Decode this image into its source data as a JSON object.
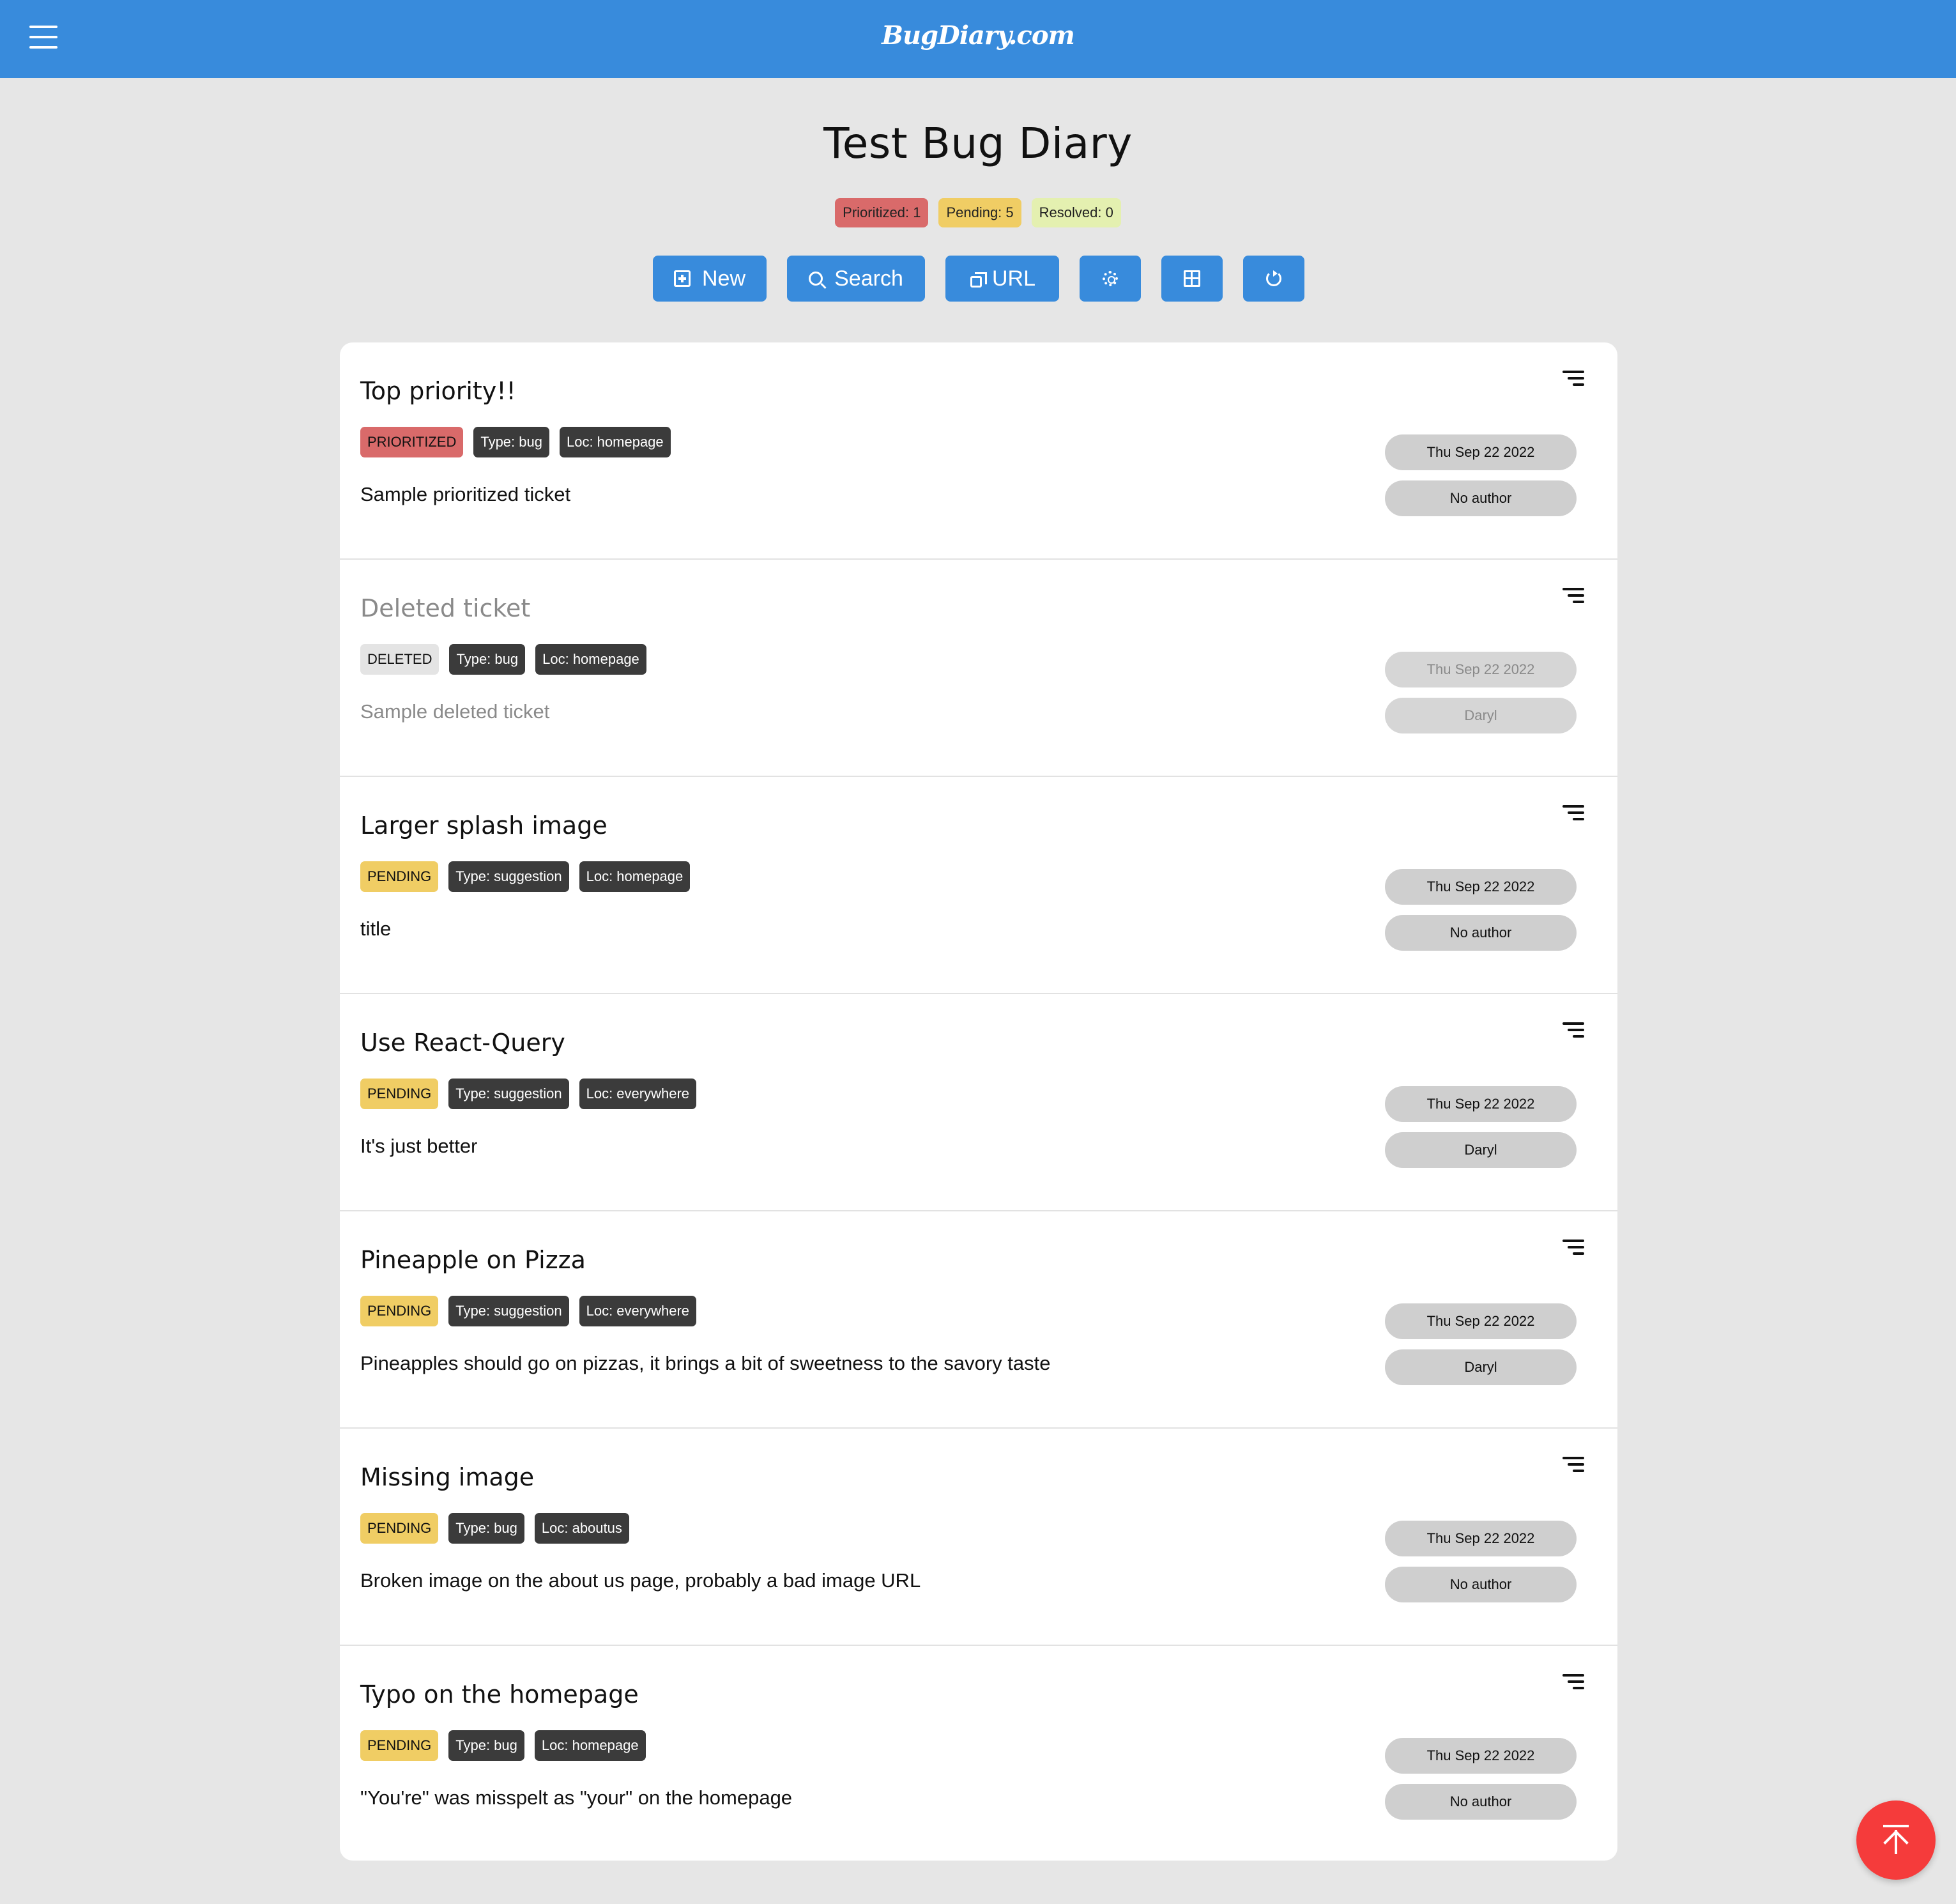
{
  "header": {
    "brand": "BugDiary.com",
    "menu_icon": "hamburger-icon"
  },
  "page": {
    "title": "Test Bug Diary"
  },
  "stats": {
    "prioritized": "Prioritized: 1",
    "pending": "Pending: 5",
    "resolved": "Resolved: 0"
  },
  "toolbar": {
    "new_label": "New",
    "search_label": "Search",
    "url_label": "URL",
    "icons": [
      "plus-box-icon",
      "search-icon",
      "copy-icon",
      "gear-icon",
      "grid-icon",
      "refresh-icon"
    ]
  },
  "tickets": [
    {
      "title": "Top priority!!",
      "status": "PRIORITIZED",
      "type": "Type: bug",
      "loc": "Loc: homepage",
      "description": "Sample prioritized ticket",
      "date": "Thu Sep 22 2022",
      "author": "No author"
    },
    {
      "title": "Deleted ticket",
      "status": "DELETED",
      "type": "Type: bug",
      "loc": "Loc: homepage",
      "description": "Sample deleted ticket",
      "date": "Thu Sep 22 2022",
      "author": "Daryl"
    },
    {
      "title": "Larger splash image",
      "status": "PENDING",
      "type": "Type: suggestion",
      "loc": "Loc: homepage",
      "description": "title",
      "date": "Thu Sep 22 2022",
      "author": "No author"
    },
    {
      "title": "Use React-Query",
      "status": "PENDING",
      "type": "Type: suggestion",
      "loc": "Loc: everywhere",
      "description": "It's just better",
      "date": "Thu Sep 22 2022",
      "author": "Daryl"
    },
    {
      "title": "Pineapple on Pizza",
      "status": "PENDING",
      "type": "Type: suggestion",
      "loc": "Loc: everywhere",
      "description": "Pineapples should go on pizzas, it brings a bit of sweetness to the savory taste",
      "date": "Thu Sep 22 2022",
      "author": "Daryl"
    },
    {
      "title": "Missing image",
      "status": "PENDING",
      "type": "Type: bug",
      "loc": "Loc: aboutus",
      "description": "Broken image on the about us page, probably a bad image URL",
      "date": "Thu Sep 22 2022",
      "author": "No author"
    },
    {
      "title": "Typo on the homepage",
      "status": "PENDING",
      "type": "Type: bug",
      "loc": "Loc: homepage",
      "description": "\"You're\" was misspelt as \"your\" on the homepage",
      "date": "Thu Sep 22 2022",
      "author": "No author"
    }
  ],
  "fab": {
    "icon": "scroll-to-top-icon"
  },
  "colors": {
    "primary": "#388bdc",
    "prioritized": "#d96a6a",
    "pending": "#f0cd64",
    "resolved": "#e4f0b0",
    "fab": "#f53b3b"
  }
}
